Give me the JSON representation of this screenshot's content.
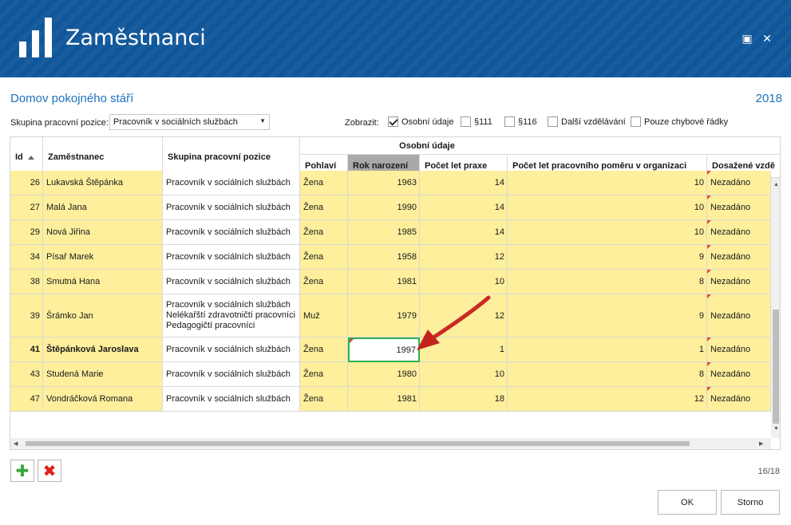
{
  "window": {
    "title": "Zaměstnanci",
    "maximize_glyph": "▣",
    "close_glyph": "✕"
  },
  "organization": "Domov pokojného stáří",
  "year": "2018",
  "filter": {
    "label": "Skupina pracovní pozice:",
    "value": "Pracovník v sociálních službách"
  },
  "show": {
    "label": "Zobrazit:",
    "options": [
      {
        "label": "Osobní údaje",
        "checked": true
      },
      {
        "label": "§111",
        "checked": false
      },
      {
        "label": "§116",
        "checked": false
      },
      {
        "label": "Další vzdělávání",
        "checked": false
      },
      {
        "label": "Pouze chybové řádky",
        "checked": false
      }
    ]
  },
  "grid": {
    "group_header": "Osobní údaje",
    "columns": {
      "id": "Id",
      "employee": "Zaměstnanec",
      "group": "Skupina pracovní pozice",
      "gender": "Pohlaví",
      "birth_year": "Rok narození",
      "practice": "Počet let praxe",
      "tenure": "Počet let pracovního poměru v organizaci",
      "education": "Dosažené vzdě"
    },
    "rows": [
      {
        "id": "26",
        "name": "Lukavská Štěpánka",
        "group": "Pracovník v sociálních službách",
        "gender": "Žena",
        "birth": "1963",
        "practice": "14",
        "tenure": "10",
        "education": "Nezadáno"
      },
      {
        "id": "27",
        "name": "Malá Jana",
        "group": "Pracovník v sociálních službách",
        "gender": "Žena",
        "birth": "1990",
        "practice": "14",
        "tenure": "10",
        "education": "Nezadáno"
      },
      {
        "id": "29",
        "name": "Nová Jiřina",
        "group": "Pracovník v sociálních službách",
        "gender": "Žena",
        "birth": "1985",
        "practice": "14",
        "tenure": "10",
        "education": "Nezadáno"
      },
      {
        "id": "34",
        "name": "Písař Marek",
        "group": "Pracovník v sociálních službách",
        "gender": "Žena",
        "birth": "1958",
        "practice": "12",
        "tenure": "9",
        "education": "Nezadáno"
      },
      {
        "id": "38",
        "name": "Smutná Hana",
        "group": "Pracovník v sociálních službách",
        "gender": "Žena",
        "birth": "1981",
        "practice": "10",
        "tenure": "8",
        "education": "Nezadáno"
      },
      {
        "id": "39",
        "name": "Šrámko Jan",
        "group": "Pracovník v sociálních službách Nelékařští zdravotničtí pracovníci Pedagogičtí pracovníci",
        "gender": "Muž",
        "birth": "1979",
        "practice": "12",
        "tenure": "9",
        "education": "Nezadáno"
      },
      {
        "id": "41",
        "name": "Štěpánková Jaroslava",
        "group": "Pracovník v sociálních službách",
        "gender": "Žena",
        "birth": "1997",
        "practice": "1",
        "tenure": "1",
        "education": "Nezadáno",
        "selected": true
      },
      {
        "id": "43",
        "name": "Studená Marie",
        "group": "Pracovník v sociálních službách",
        "gender": "Žena",
        "birth": "1980",
        "practice": "10",
        "tenure": "8",
        "education": "Nezadáno"
      },
      {
        "id": "47",
        "name": "Vondráčková Romana",
        "group": "Pracovník v sociálních službách",
        "gender": "Žena",
        "birth": "1981",
        "practice": "18",
        "tenure": "12",
        "education": "Nezadáno"
      }
    ]
  },
  "actions": {
    "add_glyph": "✚",
    "delete_glyph": "✖"
  },
  "counter": "16/18",
  "buttons": {
    "ok": "OK",
    "cancel": "Storno"
  },
  "colors": {
    "title_bar": "#10569a",
    "accent": "#1e73be",
    "editable_cell": "#fdef9c",
    "selection": "#2db04b",
    "error_flag": "#e8442c"
  }
}
